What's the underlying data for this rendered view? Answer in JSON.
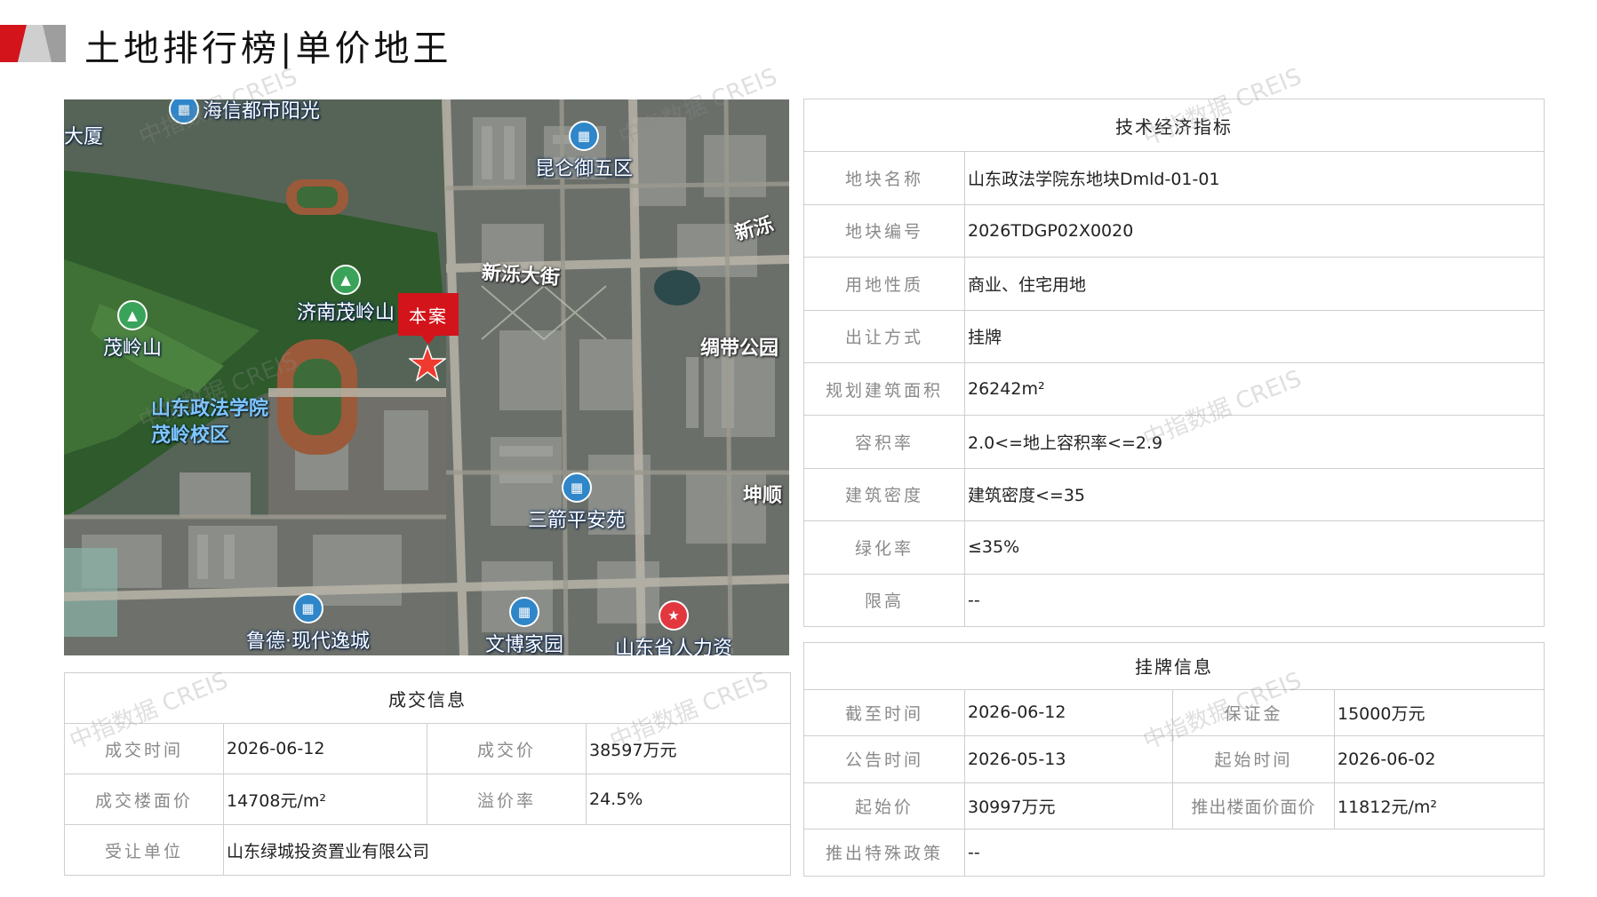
{
  "header": {
    "title": "土地排行榜|单价地王"
  },
  "map": {
    "project_tag": "本案",
    "pois": {
      "top_left": "海信都市阳光",
      "kunlun": "昆仑御五区",
      "xinlu": "新泺大街",
      "jinan_maoling": "济南茂岭山",
      "maoling": "茂岭山",
      "sdzf": "山东政法学院茂岭校区",
      "silk": "绸带公园",
      "sanjian": "三箭平安苑",
      "kunshun": "坤顺",
      "luyi": "鲁德·现代逸城",
      "wenbo": "文博家园",
      "sdzr": "山东省人力资",
      "edge_tl": "大厦",
      "edge_tr": "新泺"
    }
  },
  "tech": {
    "title": "技术经济指标",
    "rows": [
      {
        "label": "地块名称",
        "value": "山东政法学院东地块Dmld-01-01"
      },
      {
        "label": "地块编号",
        "value": "2026TDGP02X0020"
      },
      {
        "label": "用地性质",
        "value": "商业、住宅用地"
      },
      {
        "label": "出让方式",
        "value": "挂牌"
      },
      {
        "label": "规划建筑面积",
        "value": "26242m²"
      },
      {
        "label": "容积率",
        "value": "2.0<=地上容积率<=2.9"
      },
      {
        "label": "建筑密度",
        "value": "建筑密度<=35"
      },
      {
        "label": "绿化率",
        "value": "≤35%"
      },
      {
        "label": "限高",
        "value": "--"
      }
    ]
  },
  "deal": {
    "title": "成交信息",
    "time_label": "成交时间",
    "time_value": "2026-06-12",
    "price_label": "成交价",
    "price_value": "38597万元",
    "unit_label": "成交楼面价",
    "unit_value": "14708元/m²",
    "premium_label": "溢价率",
    "premium_value": "24.5%",
    "buyer_label": "受让单位",
    "buyer_value": "山东绿城投资置业有限公司"
  },
  "listing": {
    "title": "挂牌信息",
    "end_label": "截至时间",
    "end_value": "2026-06-12",
    "deposit_label": "保证金",
    "deposit_value": "15000万元",
    "announce_label": "公告时间",
    "announce_value": "2026-05-13",
    "start_time_label": "起始时间",
    "start_time_value": "2026-06-02",
    "start_price_label": "起始价",
    "start_price_value": "30997万元",
    "floor_price_label": "推出楼面价面价",
    "floor_price_value": "11812元/m²",
    "policy_label": "推出特殊政策",
    "policy_value": "--"
  },
  "watermark": {
    "text": "中指数据 CREIS"
  }
}
